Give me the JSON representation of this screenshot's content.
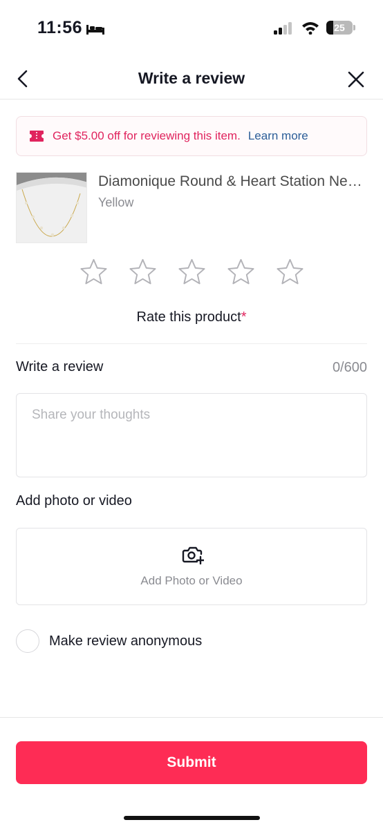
{
  "status_bar": {
    "time": "11:56",
    "battery_level": "25",
    "battery_fraction": 0.25
  },
  "header": {
    "title": "Write a review",
    "back_icon": "chevron-left-icon",
    "close_icon": "close-icon"
  },
  "promo": {
    "text": "Get $5.00 off for reviewing this item.",
    "link": "Learn more",
    "icon": "ticket-icon",
    "color": "#e0245e",
    "link_color": "#2b5d98"
  },
  "product": {
    "name": "Diamonique Round & Heart Station Necklace",
    "variant": "Yellow"
  },
  "rating": {
    "max_stars": 5,
    "selected": 0,
    "label": "Rate this product",
    "required_marker": "*"
  },
  "review": {
    "label": "Write a review",
    "counter": "0/600",
    "value": "",
    "placeholder": "Share your thoughts"
  },
  "media": {
    "label": "Add photo or video",
    "button_text": "Add Photo or Video",
    "icon": "camera-plus-icon"
  },
  "anonymous": {
    "label": "Make review anonymous",
    "checked": false
  },
  "submit": {
    "label": "Submit",
    "color": "#fe2c55"
  }
}
